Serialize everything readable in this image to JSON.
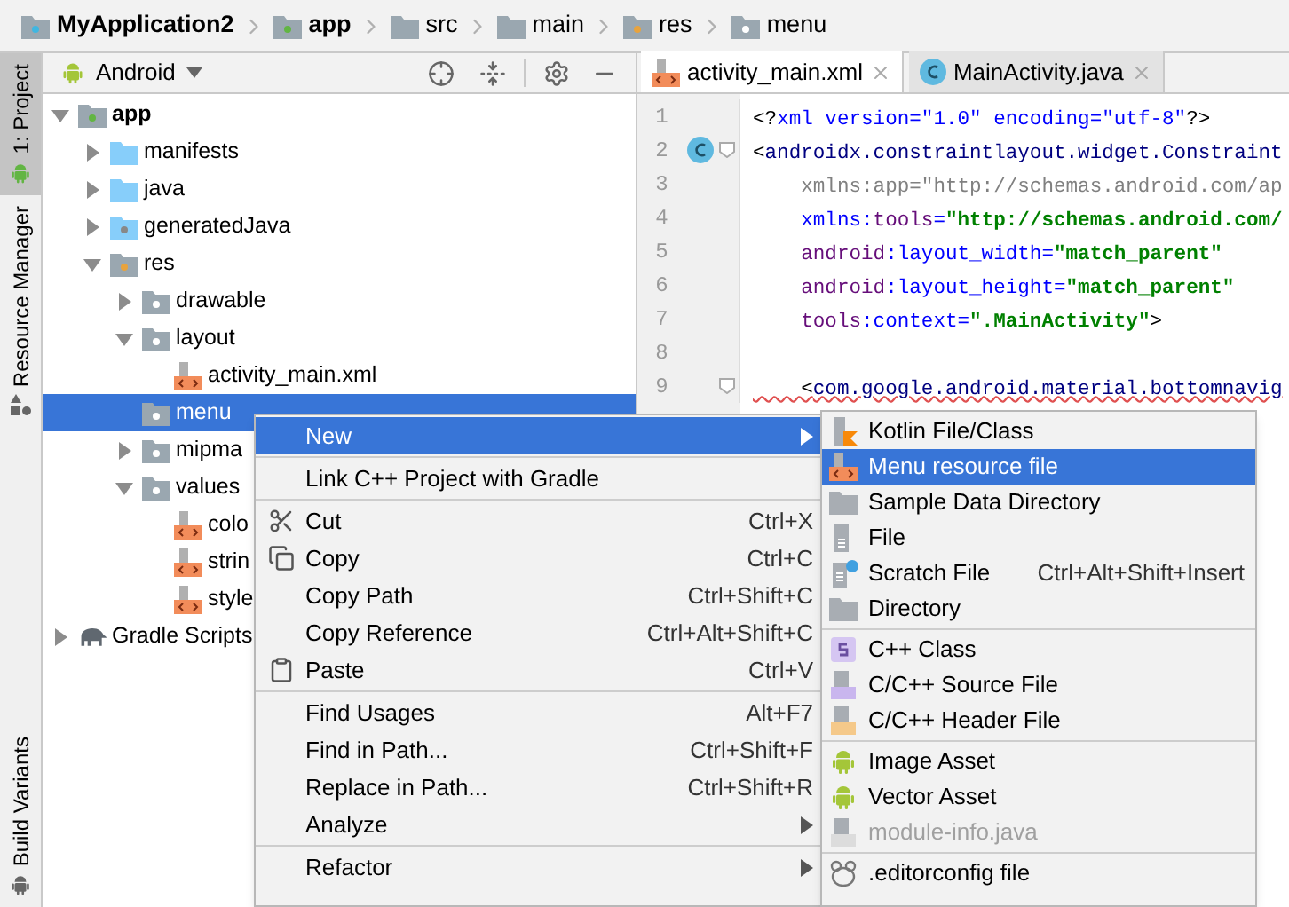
{
  "breadcrumbs": [
    {
      "label": "MyApplication2",
      "kind": "project"
    },
    {
      "label": "app",
      "kind": "module"
    },
    {
      "label": "src",
      "kind": "folder"
    },
    {
      "label": "main",
      "kind": "folder"
    },
    {
      "label": "res",
      "kind": "res"
    },
    {
      "label": "menu",
      "kind": "package"
    }
  ],
  "tool_strip": {
    "top": [
      {
        "label": "1: Project",
        "selected": true
      },
      {
        "label": "Resource Manager",
        "selected": false
      }
    ],
    "bottom": [
      {
        "label": "Build Variants",
        "selected": false
      }
    ]
  },
  "project_panel": {
    "view_selector": "Android",
    "tree": [
      {
        "label": "app",
        "kind": "module",
        "expanded": true,
        "selected": false,
        "children": [
          {
            "label": "manifests",
            "kind": "folder-blue",
            "expanded": false,
            "selected": false
          },
          {
            "label": "java",
            "kind": "folder-blue",
            "expanded": false,
            "selected": false
          },
          {
            "label": "generatedJava",
            "kind": "folder-gen",
            "expanded": false,
            "selected": false
          },
          {
            "label": "res",
            "kind": "res",
            "expanded": true,
            "selected": false,
            "children": [
              {
                "label": "drawable",
                "kind": "package",
                "expanded": false,
                "selected": false
              },
              {
                "label": "layout",
                "kind": "package",
                "expanded": true,
                "selected": false,
                "children": [
                  {
                    "label": "activity_main.xml",
                    "kind": "xml",
                    "selected": false
                  }
                ]
              },
              {
                "label": "menu",
                "kind": "package",
                "selected": true
              },
              {
                "label": "mipma",
                "kind": "package",
                "expanded": false,
                "selected": false
              },
              {
                "label": "values",
                "kind": "package",
                "expanded": true,
                "selected": false,
                "children": [
                  {
                    "label": "colo",
                    "kind": "xml",
                    "selected": false
                  },
                  {
                    "label": "strin",
                    "kind": "xml",
                    "selected": false
                  },
                  {
                    "label": "style",
                    "kind": "xml",
                    "selected": false
                  }
                ]
              }
            ]
          }
        ]
      },
      {
        "label": "Gradle Scripts",
        "kind": "gradle",
        "expanded": false,
        "selected": false
      }
    ]
  },
  "editor": {
    "tabs": [
      {
        "label": "activity_main.xml",
        "kind": "xml",
        "selected": true
      },
      {
        "label": "MainActivity.java",
        "kind": "class",
        "selected": false
      }
    ],
    "lines": [
      {
        "number": "1",
        "class_marker": false,
        "fold": false,
        "error": false,
        "segments": [
          {
            "kind": "plain",
            "text": "<?"
          },
          {
            "kind": "attribute",
            "text": "xml version=\"1.0\" encoding=\"utf-8\""
          },
          {
            "kind": "plain",
            "text": "?>"
          }
        ]
      },
      {
        "number": "2",
        "class_marker": true,
        "fold": true,
        "error": false,
        "segments": [
          {
            "kind": "plain",
            "text": "<"
          },
          {
            "kind": "tag",
            "text": "androidx.constraintlayout.widget.Constraint"
          }
        ]
      },
      {
        "number": "3",
        "class_marker": false,
        "fold": false,
        "error": false,
        "segments": [
          {
            "kind": "unused",
            "text": "    xmlns:app=\"http://schemas.android.com/ap"
          }
        ]
      },
      {
        "number": "4",
        "class_marker": false,
        "fold": false,
        "error": false,
        "segments": [
          {
            "kind": "attribute",
            "text": "    xmlns:"
          },
          {
            "kind": "namespace",
            "text": "tools"
          },
          {
            "kind": "attribute",
            "text": "="
          },
          {
            "kind": "value",
            "text": "\"http://schemas.android.com/"
          }
        ]
      },
      {
        "number": "5",
        "class_marker": false,
        "fold": false,
        "error": false,
        "segments": [
          {
            "kind": "namespace",
            "text": "    android"
          },
          {
            "kind": "attribute",
            "text": ":layout_width="
          },
          {
            "kind": "value",
            "text": "\"match_parent\""
          }
        ]
      },
      {
        "number": "6",
        "class_marker": false,
        "fold": false,
        "error": false,
        "segments": [
          {
            "kind": "namespace",
            "text": "    android"
          },
          {
            "kind": "attribute",
            "text": ":layout_height="
          },
          {
            "kind": "value",
            "text": "\"match_parent\""
          }
        ]
      },
      {
        "number": "7",
        "class_marker": false,
        "fold": false,
        "error": false,
        "segments": [
          {
            "kind": "namespace",
            "text": "    tools"
          },
          {
            "kind": "attribute",
            "text": ":context="
          },
          {
            "kind": "value",
            "text": "\".MainActivity\""
          },
          {
            "kind": "plain",
            "text": ">"
          }
        ]
      },
      {
        "number": "8",
        "class_marker": false,
        "fold": false
      },
      {
        "number": "9",
        "class_marker": false,
        "fold": true,
        "error": true,
        "segments": [
          {
            "kind": "plain",
            "text": "    <"
          },
          {
            "kind": "tag",
            "text": "com.google.android.material.bottomnavig"
          }
        ]
      }
    ]
  },
  "context_menu": {
    "items": [
      {
        "kind": "plain",
        "label": "New",
        "submenu": true,
        "selected": true
      },
      {
        "kind": "separator"
      },
      {
        "kind": "plain",
        "label": "Link C++ Project with Gradle",
        "submenu": false,
        "selected": false
      },
      {
        "kind": "separator"
      },
      {
        "kind": "cut",
        "label": "Cut",
        "shortcut": "Ctrl+X",
        "submenu": false,
        "selected": false
      },
      {
        "kind": "copy",
        "label": "Copy",
        "shortcut": "Ctrl+C",
        "submenu": false,
        "selected": false
      },
      {
        "kind": "plain",
        "label": "Copy Path",
        "shortcut": "Ctrl+Shift+C",
        "submenu": false,
        "selected": false
      },
      {
        "kind": "plain",
        "label": "Copy Reference",
        "shortcut": "Ctrl+Alt+Shift+C",
        "submenu": false,
        "selected": false
      },
      {
        "kind": "paste",
        "label": "Paste",
        "shortcut": "Ctrl+V",
        "submenu": false,
        "selected": false
      },
      {
        "kind": "separator"
      },
      {
        "kind": "plain",
        "label": "Find Usages",
        "shortcut": "Alt+F7",
        "submenu": false,
        "selected": false
      },
      {
        "kind": "plain",
        "label": "Find in Path...",
        "shortcut": "Ctrl+Shift+F",
        "submenu": false,
        "selected": false
      },
      {
        "kind": "plain",
        "label": "Replace in Path...",
        "shortcut": "Ctrl+Shift+R",
        "submenu": false,
        "selected": false
      },
      {
        "kind": "plain",
        "label": "Analyze",
        "submenu": true,
        "selected": false
      },
      {
        "kind": "separator"
      },
      {
        "kind": "plain",
        "label": "Refactor",
        "submenu": true,
        "selected": false
      }
    ]
  },
  "submenu": {
    "items": [
      {
        "kind": "kotlin",
        "label": "Kotlin File/Class",
        "selected": false,
        "disabled": false
      },
      {
        "kind": "xml",
        "label": "Menu resource file",
        "selected": true,
        "disabled": false
      },
      {
        "kind": "folder",
        "label": "Sample Data Directory",
        "selected": false,
        "disabled": false
      },
      {
        "kind": "file",
        "label": "File",
        "selected": false,
        "disabled": false
      },
      {
        "kind": "scratch",
        "label": "Scratch File",
        "shortcut": "Ctrl+Alt+Shift+Insert",
        "selected": false,
        "disabled": false
      },
      {
        "kind": "folder",
        "label": "Directory",
        "selected": false,
        "disabled": false
      },
      {
        "kind": "separator"
      },
      {
        "kind": "cpp-class",
        "label": "C++ Class",
        "selected": false,
        "disabled": false
      },
      {
        "kind": "cpp-source",
        "label": "C/C++ Source File",
        "selected": false,
        "disabled": false
      },
      {
        "kind": "cpp-header",
        "label": "C/C++ Header File",
        "selected": false,
        "disabled": false
      },
      {
        "kind": "separator"
      },
      {
        "kind": "android",
        "label": "Image Asset",
        "selected": false,
        "disabled": false
      },
      {
        "kind": "android",
        "label": "Vector Asset",
        "selected": false,
        "disabled": false
      },
      {
        "kind": "java-file",
        "label": "module-info.java",
        "selected": false,
        "disabled": true
      },
      {
        "kind": "separator"
      },
      {
        "kind": "editorconfig",
        "label": ".editorconfig file",
        "selected": false,
        "disabled": false
      }
    ]
  }
}
